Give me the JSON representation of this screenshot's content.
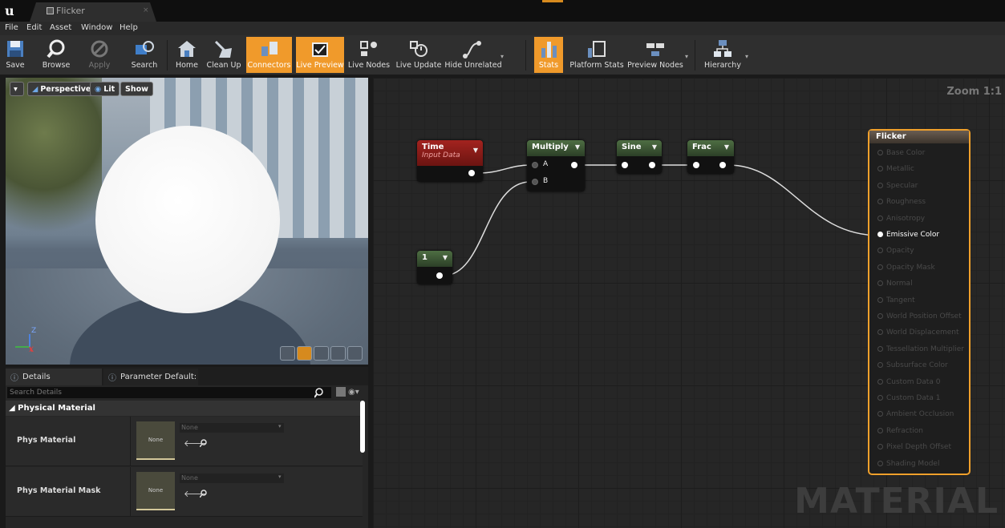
{
  "titlebar": {
    "logo": "u",
    "tab_label": "Flicker",
    "tab_close": "×"
  },
  "menu": [
    "File",
    "Edit",
    "Asset",
    "Window",
    "Help"
  ],
  "toolbar": [
    {
      "label": "Save",
      "icon": "save-icon",
      "active": false
    },
    {
      "label": "Browse",
      "icon": "browse-icon",
      "active": false
    },
    {
      "label": "Apply",
      "icon": "apply-icon",
      "active": false
    },
    {
      "label": "Search",
      "icon": "search-icon",
      "active": false
    },
    {
      "label": "Home",
      "icon": "home-icon",
      "active": false
    },
    {
      "label": "Clean Up",
      "icon": "cleanup-icon",
      "active": false
    },
    {
      "label": "Connectors",
      "icon": "connectors-icon",
      "active": true
    },
    {
      "label": "Live Preview",
      "icon": "live-preview-icon",
      "active": true
    },
    {
      "label": "Live Nodes",
      "icon": "live-nodes-icon",
      "active": false
    },
    {
      "label": "Live Update",
      "icon": "live-update-icon",
      "active": false
    },
    {
      "label": "Hide Unrelated",
      "icon": "hide-unrelated-icon",
      "active": false
    },
    {
      "label": "Stats",
      "icon": "stats-icon",
      "active": true
    },
    {
      "label": "Platform Stats",
      "icon": "platform-stats-icon",
      "active": false
    },
    {
      "label": "Preview Nodes",
      "icon": "preview-nodes-icon",
      "active": false
    },
    {
      "label": "Hierarchy",
      "icon": "hierarchy-icon",
      "active": false
    }
  ],
  "viewport": {
    "perspective": "Perspective",
    "lit": "Lit",
    "show": "Show",
    "axis_z": "Z",
    "axis_x": "X"
  },
  "details": {
    "tab_details": "Details",
    "tab_params": "Parameter Default:",
    "search_placeholder": "Search Details",
    "category": "Physical Material",
    "rows": [
      {
        "label": "Phys Material",
        "thumb": "None",
        "combo": "None"
      },
      {
        "label": "Phys Material Mask",
        "thumb": "None",
        "combo": "None"
      }
    ]
  },
  "graph": {
    "zoom": "Zoom 1:1",
    "watermark": "MATERIAL",
    "nodes": {
      "time": {
        "title": "Time",
        "subtitle": "Input Data"
      },
      "multiply": {
        "title": "Multiply",
        "pin_a": "A",
        "pin_b": "B"
      },
      "sine": {
        "title": "Sine"
      },
      "frac": {
        "title": "Frac"
      },
      "constant": {
        "title": "1"
      }
    },
    "result": {
      "title": "Flicker",
      "inputs": [
        {
          "label": "Base Color",
          "connected": false
        },
        {
          "label": "Metallic",
          "connected": false
        },
        {
          "label": "Specular",
          "connected": false
        },
        {
          "label": "Roughness",
          "connected": false
        },
        {
          "label": "Anisotropy",
          "connected": false
        },
        {
          "label": "Emissive Color",
          "connected": true
        },
        {
          "label": "Opacity",
          "connected": false
        },
        {
          "label": "Opacity Mask",
          "connected": false
        },
        {
          "label": "Normal",
          "connected": false
        },
        {
          "label": "Tangent",
          "connected": false
        },
        {
          "label": "World Position Offset",
          "connected": false
        },
        {
          "label": "World Displacement",
          "connected": false
        },
        {
          "label": "Tessellation Multiplier",
          "connected": false
        },
        {
          "label": "Subsurface Color",
          "connected": false
        },
        {
          "label": "Custom Data 0",
          "connected": false
        },
        {
          "label": "Custom Data 1",
          "connected": false
        },
        {
          "label": "Ambient Occlusion",
          "connected": false
        },
        {
          "label": "Refraction",
          "connected": false
        },
        {
          "label": "Pixel Depth Offset",
          "connected": false
        },
        {
          "label": "Shading Model",
          "connected": false
        }
      ]
    }
  },
  "colors": {
    "accent": "#f09a2b",
    "result_border": "#f0a02b",
    "time_header": "#a3231f",
    "math_header": "#4e6e43"
  }
}
